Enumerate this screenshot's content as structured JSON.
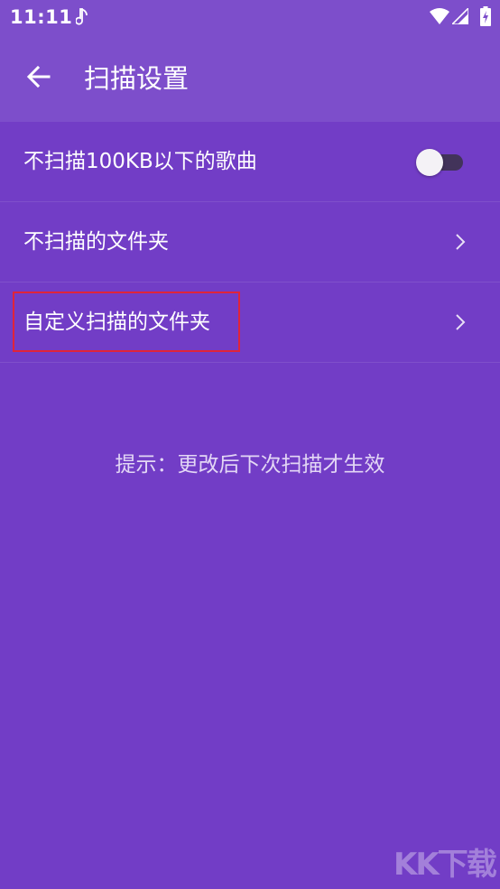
{
  "status_bar": {
    "time": "11:11",
    "icons": [
      "music-note-icon",
      "wifi-icon",
      "signal-icon",
      "battery-charging-icon"
    ]
  },
  "app_bar": {
    "title": "扫描设置",
    "back_icon": "arrow-left-icon"
  },
  "settings": {
    "items": [
      {
        "label": "不扫描100KB以下的歌曲",
        "control": "toggle",
        "toggle_on": false
      },
      {
        "label": "不扫描的文件夹",
        "control": "chevron-right-icon"
      },
      {
        "label": "自定义扫描的文件夹",
        "control": "chevron-right-icon",
        "highlighted": true
      }
    ]
  },
  "hint": "提示：更改后下次扫描才生效",
  "watermark": "KK下载",
  "colors": {
    "background": "#723dc6",
    "app_bar": "#7d4ecb",
    "highlight_border": "#e0243a",
    "text": "#ffffff",
    "hint_text": "#e3d7f5"
  }
}
